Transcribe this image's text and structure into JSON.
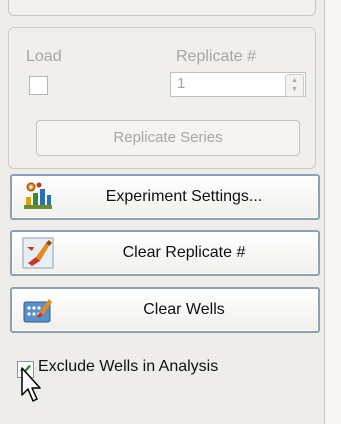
{
  "load": {
    "label": "Load",
    "checked": false
  },
  "replicate": {
    "label": "Replicate #",
    "value": "1"
  },
  "replicate_series": {
    "label": "Replicate Series"
  },
  "buttons": {
    "experiment_settings": "Experiment Settings...",
    "clear_replicate": "Clear Replicate #",
    "clear_wells": "Clear Wells"
  },
  "exclude": {
    "label": "Exclude Wells in Analysis",
    "checked": true
  }
}
